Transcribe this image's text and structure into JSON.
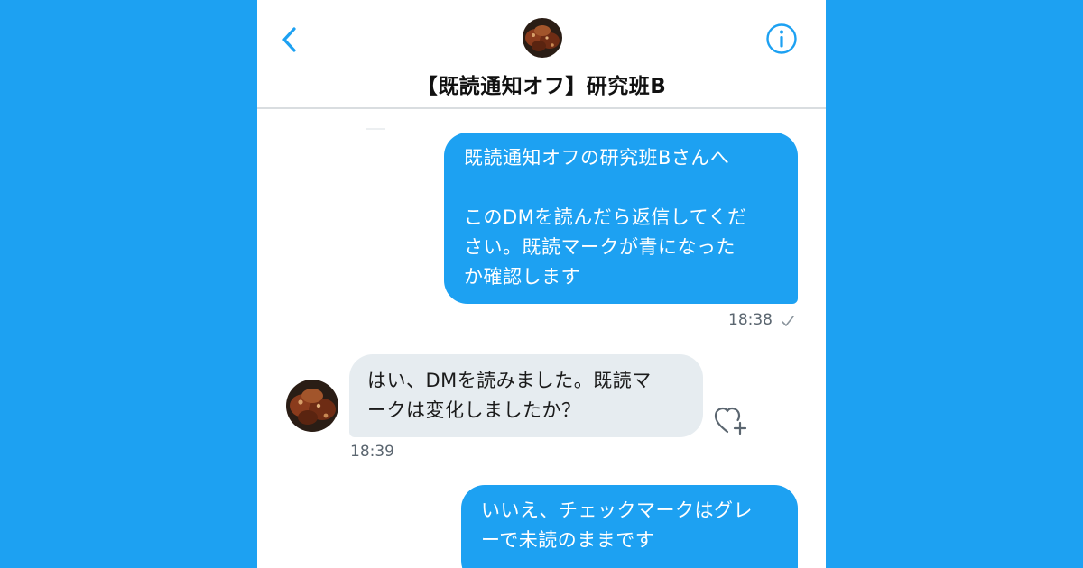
{
  "header": {
    "title": "【既読通知オフ】研究班B",
    "back_icon": "chevron-left-icon",
    "info_icon": "info-icon",
    "accent_color": "#1da1f2"
  },
  "messages": [
    {
      "direction": "outgoing",
      "text": "既読通知オフの研究班Bさんへ\n\nこのDMを読んだら返信してくだ\nさい。既読マークが青になった\nか確認します",
      "time": "18:38",
      "status_icon": "sent-check-icon"
    },
    {
      "direction": "incoming",
      "text": "はい、DMを読みました。既読マ\nークは変化しましたか？",
      "time": "18:39",
      "reaction_icon": "heart-plus-icon"
    },
    {
      "direction": "outgoing",
      "text": "いいえ、チェックマークはグレ\nーで未読のままです"
    }
  ],
  "colors": {
    "background": "#1da1f2",
    "outgoing_bubble": "#1da1f2",
    "incoming_bubble": "#e6ecf0",
    "timestamp": "#5b6670"
  }
}
